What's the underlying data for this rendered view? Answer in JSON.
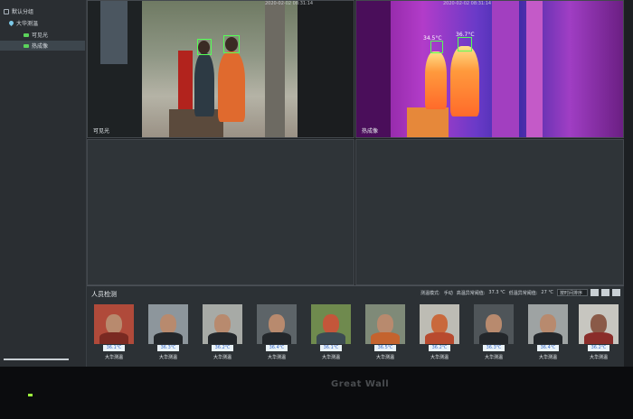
{
  "sidebar": {
    "items": [
      {
        "label": "默认分组",
        "icon": "group-icon"
      },
      {
        "label": "大华测温",
        "icon": "location-pin-icon"
      },
      {
        "label": "可见光",
        "icon": "camera-icon"
      },
      {
        "label": "热成像",
        "icon": "camera-icon"
      }
    ]
  },
  "video": {
    "visible": {
      "label": "可见光",
      "timestamp": "2020-02-02 08:31:14"
    },
    "thermal": {
      "label": "热成像",
      "timestamp": "2020-02-02 08:31:14",
      "temp1": "34.5°C",
      "temp2": "36.7°C"
    }
  },
  "panel": {
    "title": "人员检测",
    "options": {
      "detect_mode_label": "测温模式:",
      "detect_mode_value": "手动",
      "high_alarm_label": "高温异常阈值:",
      "high_alarm_value": "37.3 ℃",
      "low_alarm_label": "低温异常阈值:",
      "low_alarm_value": "27 ℃",
      "sort_value": "按时间排序"
    },
    "records": [
      {
        "temp": "36.1℃",
        "name": "大华测温"
      },
      {
        "temp": "36.3℃",
        "name": "大华测温"
      },
      {
        "temp": "36.2℃",
        "name": "大华测温"
      },
      {
        "temp": "36.4℃",
        "name": "大华测温"
      },
      {
        "temp": "36.1℃",
        "name": "大华测温"
      },
      {
        "temp": "36.5℃",
        "name": "大华测温"
      },
      {
        "temp": "36.2℃",
        "name": "大华测温"
      },
      {
        "temp": "36.3℃",
        "name": "大华测温"
      },
      {
        "temp": "36.4℃",
        "name": "大华测温"
      },
      {
        "temp": "36.2℃",
        "name": "大华测温"
      }
    ]
  },
  "monitor": {
    "brand": "Great Wall"
  },
  "colors": {
    "face_box": "#55ff55",
    "temp_text": "#3a6bc8",
    "power_led": "#9dff3c"
  }
}
